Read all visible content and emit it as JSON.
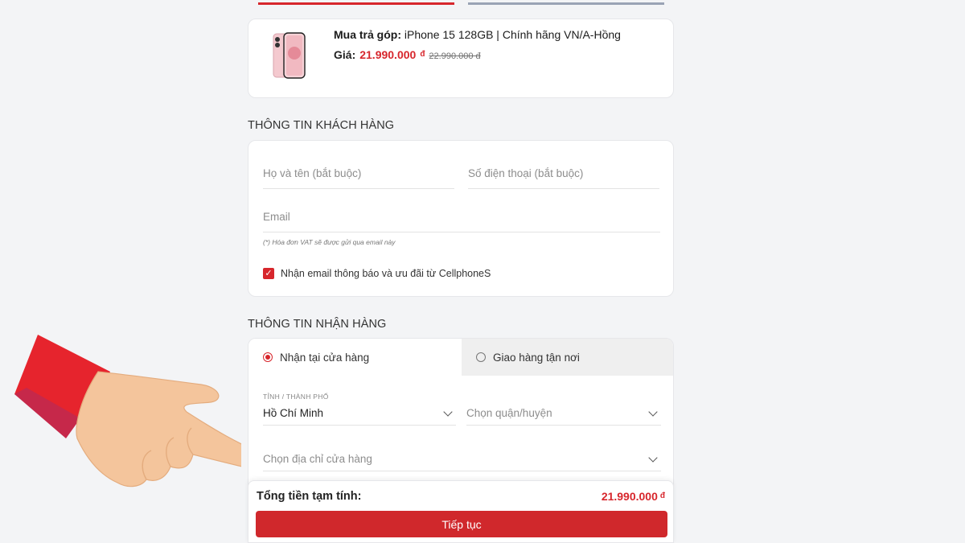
{
  "product": {
    "name_prefix": "Mua trả góp:",
    "name": " iPhone 15 128GB | Chính hãng VN/A-Hồng",
    "price_label": "Giá:",
    "price": "21.990.000",
    "currency": "đ",
    "old_price": "22.990.000 đ"
  },
  "customer": {
    "title": "THÔNG TIN KHÁCH HÀNG",
    "name_placeholder": "Họ và tên (bắt buộc)",
    "phone_placeholder": "Số điện thoại (bắt buộc)",
    "email_placeholder": "Email",
    "email_note": "(*) Hóa đơn VAT sẽ được gửi qua email này",
    "subscribe_label": "Nhận email thông báo và ưu đãi từ CellphoneS",
    "subscribe_checked": true
  },
  "delivery": {
    "title": "THÔNG TIN NHẬN HÀNG",
    "tab_store": "Nhận tại cửa hàng",
    "tab_home": "Giao hàng tận nơi",
    "city_label": "TỈNH / THÀNH PHỐ",
    "city_value": "Hồ Chí Minh",
    "district_placeholder": "Chọn quận/huyện",
    "store_placeholder": "Chọn địa chỉ cửa hàng"
  },
  "total": {
    "label": "Tổng tiền tạm tính:",
    "amount": "21.990.000",
    "currency": "đ",
    "continue_label": "Tiếp tục"
  },
  "colors": {
    "accent": "#d7262c",
    "inactive_tab": "#9aa3b5"
  }
}
